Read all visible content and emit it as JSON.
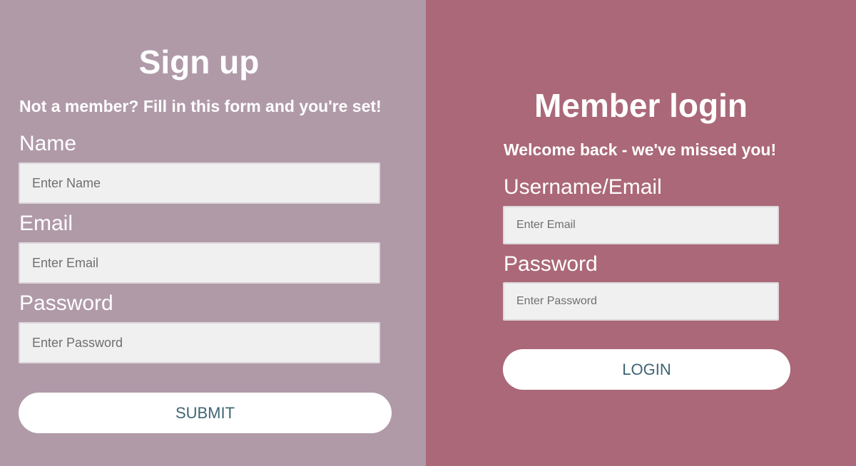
{
  "signup": {
    "title": "Sign up",
    "subtitle": "Not a member? Fill in this form and you're set!",
    "name_label": "Name",
    "name_placeholder": "Enter Name",
    "email_label": "Email",
    "email_placeholder": "Enter Email",
    "password_label": "Password",
    "password_placeholder": "Enter Password",
    "submit_label": "SUBMIT"
  },
  "login": {
    "title": "Member login",
    "subtitle": "Welcome back - we've missed you!",
    "username_label": "Username/Email",
    "username_placeholder": "Enter Email",
    "password_label": "Password",
    "password_placeholder": "Enter Password",
    "login_label": "LOGIN"
  },
  "colors": {
    "signup_background": "#b09aa8",
    "login_background": "#ab6878",
    "button_text": "#3f6573",
    "input_background": "#f1f0f0"
  }
}
